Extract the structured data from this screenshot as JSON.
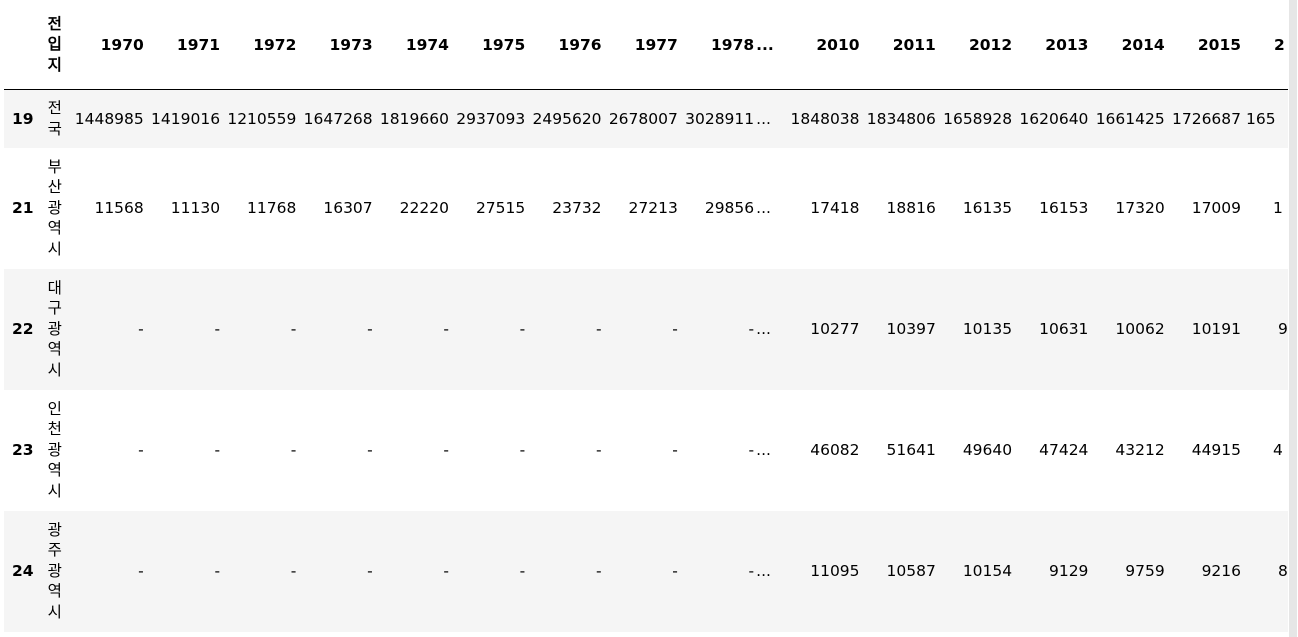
{
  "table": {
    "index_header": "",
    "name_header": "전입지",
    "columns": [
      "1970",
      "1971",
      "1972",
      "1973",
      "1974",
      "1975",
      "1976",
      "1977",
      "1978",
      "...",
      "2010",
      "2011",
      "2012",
      "2013",
      "2014",
      "2015",
      "2"
    ],
    "rows": [
      {
        "index": "19",
        "name": "전국",
        "cells": [
          "1448985",
          "1419016",
          "1210559",
          "1647268",
          "1819660",
          "2937093",
          "2495620",
          "2678007",
          "3028911",
          "...",
          "1848038",
          "1834806",
          "1658928",
          "1620640",
          "1661425",
          "1726687",
          "165"
        ]
      },
      {
        "index": "21",
        "name": "부산광역시",
        "cells": [
          "11568",
          "11130",
          "11768",
          "16307",
          "22220",
          "27515",
          "23732",
          "27213",
          "29856",
          "...",
          "17418",
          "18816",
          "16135",
          "16153",
          "17320",
          "17009",
          "1"
        ]
      },
      {
        "index": "22",
        "name": "대구광역시",
        "cells": [
          "-",
          "-",
          "-",
          "-",
          "-",
          "-",
          "-",
          "-",
          "-",
          "...",
          "10277",
          "10397",
          "10135",
          "10631",
          "10062",
          "10191",
          "9"
        ]
      },
      {
        "index": "23",
        "name": "인천광역시",
        "cells": [
          "-",
          "-",
          "-",
          "-",
          "-",
          "-",
          "-",
          "-",
          "-",
          "...",
          "46082",
          "51641",
          "49640",
          "47424",
          "43212",
          "44915",
          "4"
        ]
      },
      {
        "index": "24",
        "name": "광주광역시",
        "cells": [
          "-",
          "-",
          "-",
          "-",
          "-",
          "-",
          "-",
          "-",
          "-",
          "...",
          "11095",
          "10587",
          "10154",
          "9129",
          "9759",
          "9216",
          "8"
        ]
      }
    ]
  }
}
